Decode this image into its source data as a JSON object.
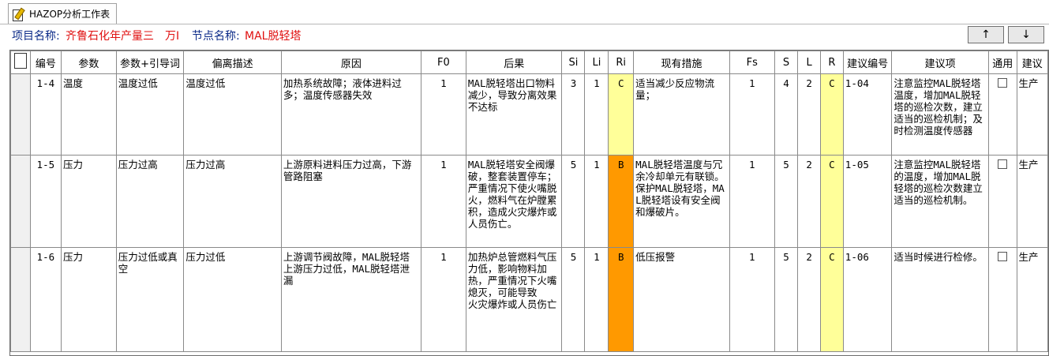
{
  "tab": {
    "label": "HAZOP分析工作表",
    "icon": "edit-sheet-icon"
  },
  "info": {
    "project_label": "项目名称:",
    "project_value": "齐鲁石化年产量三　万I",
    "node_label": "节点名称:",
    "node_value": "MAL脱轻塔"
  },
  "nav": {
    "up_label": "↑",
    "down_label": "↓"
  },
  "columns": [
    "编号",
    "参数",
    "参数+引导词",
    "偏离描述",
    "原因",
    "F0",
    "后果",
    "Si",
    "Li",
    "Ri",
    "现有措施",
    "Fs",
    "S",
    "L",
    "R",
    "建议编号",
    "建议项",
    "通用",
    "建议"
  ],
  "rows": [
    {
      "no": "1-4",
      "param": "温度",
      "param_guide": "温度过低",
      "deviation": "温度过低",
      "cause": "加热系统故障；液体进料过多；温度传感器失效",
      "f0": "1",
      "consequence": "MAL脱轻塔出口物料减少，导致分离效果不达标",
      "si": "3",
      "li": "1",
      "ri": "C",
      "measures": "适当减少反应物流量；",
      "fs": "1",
      "s": "4",
      "l": "2",
      "r": "C",
      "sug_no": "1-04",
      "suggestion": "注意监控MAL脱轻塔温度，增加MAL脱轻塔的巡检次数，建立适当的巡检机制；及时检测温度传感器",
      "general": false,
      "sug2": "生产"
    },
    {
      "no": "1-5",
      "param": "压力",
      "param_guide": "压力过高",
      "deviation": "压力过高",
      "cause": "上游原料进料压力过高，下游管路阻塞",
      "f0": "1",
      "consequence": "MAL脱轻塔安全阀爆破，整套装置停车；严重情况下使火嘴脱火，燃料气在炉膛累积，造成火灾爆炸或人员伤亡。",
      "si": "5",
      "li": "1",
      "ri": "B",
      "measures": "MAL脱轻塔温度与冗余冷却单元有联锁。保护MAL脱轻塔，MAL脱轻塔设有安全阀和爆破片。",
      "fs": "1",
      "s": "5",
      "l": "2",
      "r": "C",
      "sug_no": "1-05",
      "suggestion": "注意监控MAL脱轻塔的温度，增加MAL脱轻塔的巡检次数建立适当的巡检机制。",
      "general": false,
      "sug2": "生产"
    },
    {
      "no": "1-6",
      "param": "压力",
      "param_guide": "压力过低或真空",
      "deviation": "压力过低",
      "cause": "上游调节阀故障，MAL脱轻塔上游压力过低，MAL脱轻塔泄漏",
      "f0": "1",
      "consequence": "加热炉总管燃料气压力低，影响物料加热，严重情况下火嘴熄灭，可能导致\n火灾爆炸或人员伤亡",
      "si": "5",
      "li": "1",
      "ri": "B",
      "measures": "低压报警",
      "fs": "1",
      "s": "5",
      "l": "2",
      "r": "C",
      "sug_no": "1-06",
      "suggestion": "适当时候进行检修。",
      "general": false,
      "sug2": "生产"
    }
  ],
  "colors": {
    "ri_c": "#ffff99",
    "ri_b": "#ff9900",
    "r_c": "#ffff99",
    "label": "#0b2a88",
    "value": "#e01010"
  }
}
